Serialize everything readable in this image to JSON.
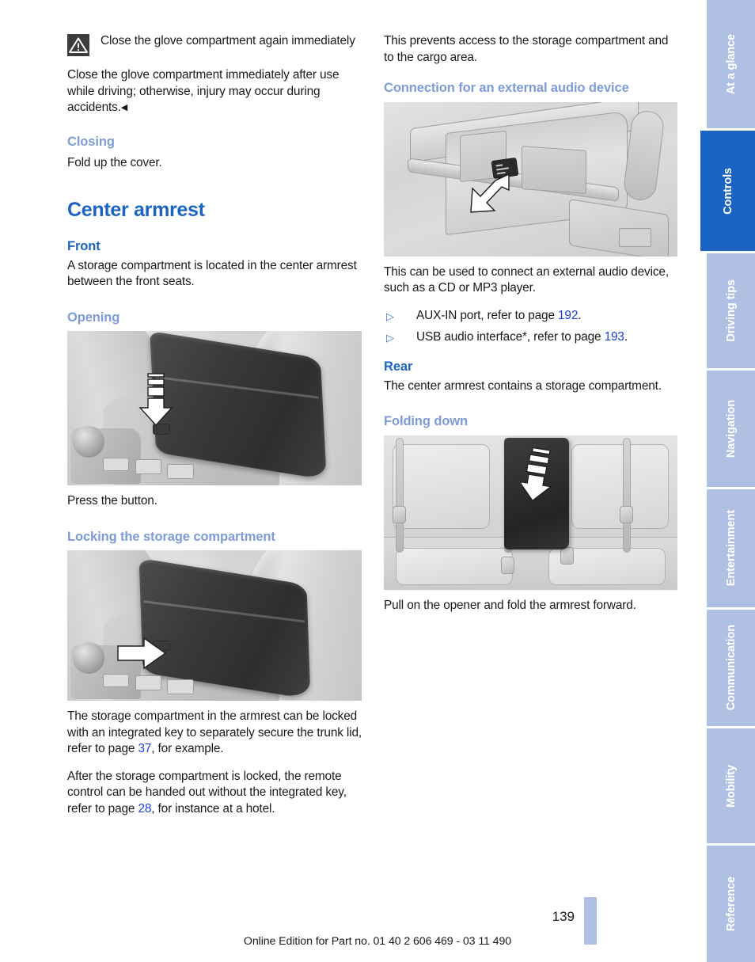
{
  "document": {
    "page_number": "139",
    "footer_text": "Online Edition for Part no. 01 40 2 606 469 - 03 11 490"
  },
  "colors": {
    "heading_primary": "#1c64c4",
    "heading_secondary": "#7e9ad8",
    "page_reference_link": "#1941d8",
    "tab_inactive_background": "#b0c0e2",
    "tab_active_background": "#1c64c4",
    "warning_icon_background": "#3c3c3c"
  },
  "left_column": {
    "warning": {
      "icon": "warning-triangle-icon",
      "title": "Close the glove compartment again immediately",
      "body_before_mark": "Close the glove compartment immediately after use while driving; otherwise, injury may occur during accidents.",
      "end_mark": "◀"
    },
    "closing": {
      "heading": "Closing",
      "text": "Fold up the cover."
    },
    "chapter_title": "Center armrest",
    "front": {
      "heading": "Front",
      "text": "A storage compartment is located in the center armrest between the front seats."
    },
    "opening": {
      "heading": "Opening",
      "figure_alt": "front-center-armrest-open-button-photo",
      "caption": "Press the button."
    },
    "locking": {
      "heading": "Locking the storage compartment",
      "figure_alt": "front-center-armrest-lock-photo",
      "paragraph_1_part_1": "The storage compartment in the armrest can be locked with an integrated key to separately secure the trunk lid, refer to page ",
      "paragraph_1_ref": "37",
      "paragraph_1_part_2": ", for example.",
      "paragraph_2_part_1": "After the storage compartment is locked, the remote control can be handed out without the integrated key, refer to page ",
      "paragraph_2_ref": "28",
      "paragraph_2_part_2": ", for instance at a hotel."
    }
  },
  "right_column": {
    "intro": "This prevents access to the storage compartment and to the cargo area.",
    "connection": {
      "heading": "Connection for an external audio device",
      "figure_alt": "center-console-aux-usb-port-illustration",
      "text": "This can be used to connect an external audio device, such as a CD or MP3 player.",
      "bullets": [
        {
          "marker": "▷",
          "text_before": "AUX-IN port, refer to page ",
          "page_ref": "192",
          "text_after": "."
        },
        {
          "marker": "▷",
          "text_before": "USB audio interface*, refer to page ",
          "page_ref": "193",
          "text_after": "."
        }
      ]
    },
    "rear": {
      "heading": "Rear",
      "text": "The center armrest contains a storage compartment."
    },
    "folding_down": {
      "heading": "Folding down",
      "figure_alt": "rear-seat-center-armrest-folding-illustration",
      "caption": "Pull on the opener and fold the armrest forward."
    }
  },
  "side_tabs": [
    {
      "label": "At a glance",
      "active": false
    },
    {
      "label": "Controls",
      "active": true
    },
    {
      "label": "Driving tips",
      "active": false
    },
    {
      "label": "Navigation",
      "active": false
    },
    {
      "label": "Entertainment",
      "active": false
    },
    {
      "label": "Communication",
      "active": false
    },
    {
      "label": "Mobility",
      "active": false
    },
    {
      "label": "Reference",
      "active": false
    }
  ]
}
